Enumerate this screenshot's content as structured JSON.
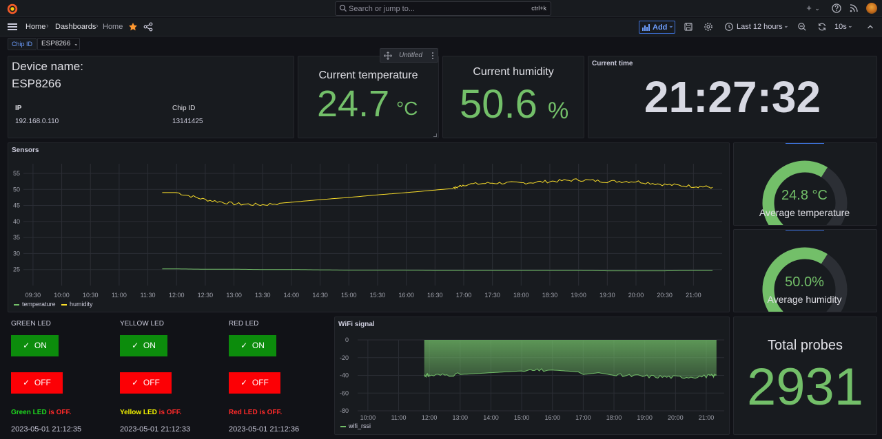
{
  "topbar": {
    "search_placeholder": "Search or jump to...",
    "search_shortcut": "ctrl+k",
    "plus_label": "+",
    "plus_caret": "⌄"
  },
  "nav": {
    "breadcrumb": [
      "Home",
      "Dashboards",
      "Home"
    ],
    "breadcrumb_sep": "›",
    "add_label": "Add",
    "time_range": "Last 12 hours",
    "refresh_interval": "10s"
  },
  "variables": {
    "label": "Chip ID",
    "value": "ESP8266",
    "caret": "⌄"
  },
  "untitled_panel": {
    "title": "Untitled"
  },
  "device_panel": {
    "heading": "Device name:",
    "name": "ESP8266",
    "table_headers": [
      "IP",
      "Chip ID"
    ],
    "table_values": [
      "192.168.0.110",
      "13141425"
    ]
  },
  "temperature_panel": {
    "title": "Current temperature",
    "value": "24.7",
    "unit": "°C"
  },
  "humidity_panel": {
    "title": "Current humidity",
    "value": "50.6",
    "unit": "%"
  },
  "time_panel": {
    "title": "Current time",
    "value": "21:27:32"
  },
  "sensors_panel": {
    "title": "Sensors",
    "y_ticks": [
      "55",
      "50",
      "45",
      "40",
      "35",
      "30",
      "25"
    ],
    "x_ticks": [
      "09:30",
      "10:00",
      "10:30",
      "11:00",
      "11:30",
      "12:00",
      "12:30",
      "13:00",
      "13:30",
      "14:00",
      "14:30",
      "15:00",
      "15:30",
      "16:00",
      "16:30",
      "17:00",
      "17:30",
      "18:00",
      "18:30",
      "19:00",
      "19:30",
      "20:00",
      "20:30",
      "21:00"
    ],
    "legend": [
      "temperature",
      "humidity"
    ]
  },
  "avg_temp_panel": {
    "value": "24.8 °C",
    "label": "Average temperature",
    "fraction": 0.62
  },
  "avg_hum_panel": {
    "value": "50.0%",
    "label": "Average humidity",
    "fraction": 0.62
  },
  "leds": [
    {
      "title": "GREEN LED",
      "on_label": "ON",
      "off_label": "OFF",
      "status_name": "Green LED",
      "status_suffix": " is OFF.",
      "timestamp": "2023-05-01 21:12:35",
      "color": "#1fd91f"
    },
    {
      "title": "YELLOW LED",
      "on_label": "ON",
      "off_label": "OFF",
      "status_name": "Yellow LED",
      "status_suffix": " is OFF.",
      "timestamp": "2023-05-01 21:12:33",
      "color": "#f2f200"
    },
    {
      "title": "RED LED",
      "on_label": "ON",
      "off_label": "OFF",
      "status_name": "Red LED",
      "status_suffix": " is OFF.",
      "timestamp": "2023-05-01 21:12:36",
      "color": "#ff2a2a"
    }
  ],
  "wifi_panel": {
    "title": "WiFi signal",
    "y_ticks": [
      "0",
      "-20",
      "-40",
      "-60",
      "-80"
    ],
    "x_ticks": [
      "10:00",
      "11:00",
      "12:00",
      "13:00",
      "14:00",
      "15:00",
      "16:00",
      "17:00",
      "18:00",
      "19:00",
      "20:00",
      "21:00"
    ],
    "legend": [
      "wifi_rssi"
    ]
  },
  "probes_panel": {
    "title": "Total probes",
    "value": "2931"
  },
  "colors": {
    "green": "#73bf69",
    "yellow": "#fade2a",
    "accent": "#3d71d9"
  },
  "chart_data": [
    {
      "type": "line",
      "title": "Sensors",
      "x": [
        "11:45",
        "12:00",
        "12:30",
        "13:00",
        "13:30",
        "14:00",
        "14:30",
        "15:00",
        "15:30",
        "16:00",
        "16:30",
        "16:50",
        "17:00",
        "17:30",
        "18:00",
        "18:30",
        "19:00",
        "19:30",
        "20:00",
        "20:30",
        "21:00",
        "21:20"
      ],
      "series": [
        {
          "name": "humidity",
          "values": [
            49,
            49,
            46.8,
            45.5,
            45.2,
            46,
            46.8,
            47.5,
            48.3,
            49,
            49.8,
            50.3,
            51.5,
            52,
            52,
            52.5,
            53,
            52.5,
            52.5,
            51.5,
            51,
            50.7
          ]
        },
        {
          "name": "temperature",
          "values": [
            25.2,
            25.2,
            25.1,
            25.1,
            25.0,
            25.0,
            24.9,
            24.8,
            24.8,
            24.8,
            24.7,
            24.7,
            24.7,
            24.7,
            24.7,
            24.7,
            24.7,
            24.6,
            24.6,
            24.6,
            24.7,
            24.7
          ]
        }
      ],
      "ylim": [
        20,
        58
      ],
      "grid": true,
      "legend": "bottom-left"
    },
    {
      "type": "area",
      "title": "WiFi signal",
      "x": [
        "11:50",
        "12:00",
        "13:00",
        "14:00",
        "15:00",
        "16:00",
        "16:50",
        "17:00",
        "17:30",
        "18:00",
        "19:00",
        "20:00",
        "21:00",
        "21:20"
      ],
      "series": [
        {
          "name": "wifi_rssi",
          "values": [
            -40,
            -40,
            -39,
            -37,
            -35,
            -34,
            -36,
            -39,
            -37,
            -40,
            -41,
            -42,
            -41,
            -40
          ]
        }
      ],
      "ylim": [
        -80,
        0
      ],
      "grid": true,
      "legend": "bottom-left"
    },
    {
      "type": "gauge",
      "title": "Average temperature",
      "value": 24.8,
      "unit": "°C"
    },
    {
      "type": "gauge",
      "title": "Average humidity",
      "value": 50.0,
      "unit": "%"
    }
  ]
}
